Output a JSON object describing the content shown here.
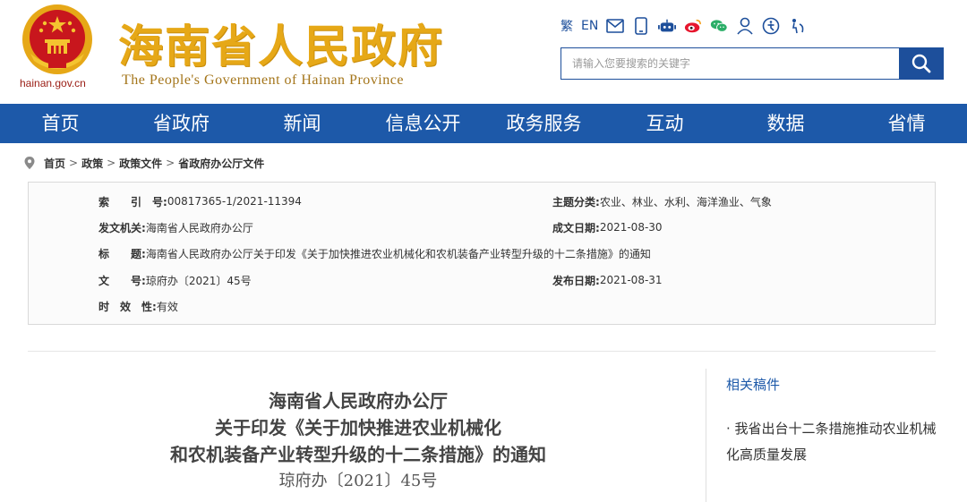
{
  "header": {
    "domain": "hainan.gov.cn",
    "title": "海南省人民政府",
    "subtitle": "The People's Government  of Hainan Province",
    "tools": {
      "traditional": "繁",
      "english": "EN"
    },
    "search_placeholder": "请输入您要搜索的关键字"
  },
  "nav": {
    "items": [
      "首页",
      "省政府",
      "新闻",
      "信息公开",
      "政务服务",
      "互动",
      "数据",
      "省情"
    ]
  },
  "breadcrumb": {
    "items": [
      "首页",
      "政策",
      "政策文件",
      "省政府办公厅文件"
    ],
    "separator": ">"
  },
  "meta": {
    "index_label": "索　　引　号:",
    "index_value": "00817365-1/2021-11394",
    "category_label": "主题分类:",
    "category_value": "农业、林业、水利、海洋渔业、气象",
    "issuer_label": "发文机关:",
    "issuer_value": "海南省人民政府办公厅",
    "created_label": "成文日期:",
    "created_value": "2021-08-30",
    "title_label": "标　　题:",
    "title_value": "海南省人民政府办公厅关于印发《关于加快推进农业机械化和农机装备产业转型升级的十二条措施》的通知",
    "docno_label": "文　　号:",
    "docno_value": "琼府办〔2021〕45号",
    "published_label": "发布日期:",
    "published_value": "2021-08-31",
    "validity_label": "时　效　性:",
    "validity_value": "有效"
  },
  "document": {
    "title_lines": [
      "海南省人民政府办公厅",
      "关于印发《关于加快推进农业机械化",
      "和农机装备产业转型升级的十二条措施》的通知"
    ],
    "number": "琼府办〔2021〕45号"
  },
  "related": {
    "heading": "相关稿件",
    "items": [
      "· 我省出台十二条措施推动农业机械化高质量发展"
    ]
  },
  "colors": {
    "nav_blue": "#1d59a9",
    "title_gold": "#e6a817",
    "emblem_red": "#c8161d"
  }
}
